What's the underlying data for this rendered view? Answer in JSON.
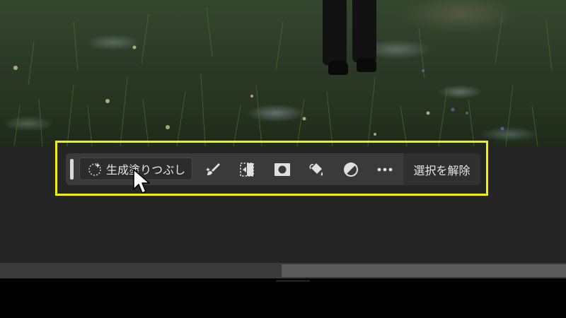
{
  "taskbar": {
    "generative_fill_label": "生成塗りつぶし",
    "deselect_label": "選択を解除",
    "tools": [
      {
        "id": "brush",
        "icon": "brush-icon"
      },
      {
        "id": "transform",
        "icon": "transform-selection-icon"
      },
      {
        "id": "mask",
        "icon": "mask-icon"
      },
      {
        "id": "fill",
        "icon": "paint-bucket-icon"
      },
      {
        "id": "adjustment",
        "icon": "adjustment-layer-icon"
      },
      {
        "id": "more",
        "icon": "more-options-icon"
      }
    ]
  },
  "colors": {
    "highlight": "#f4ee10",
    "taskbar_bg": "#3a3a3a",
    "workspace_bg": "#252525"
  }
}
